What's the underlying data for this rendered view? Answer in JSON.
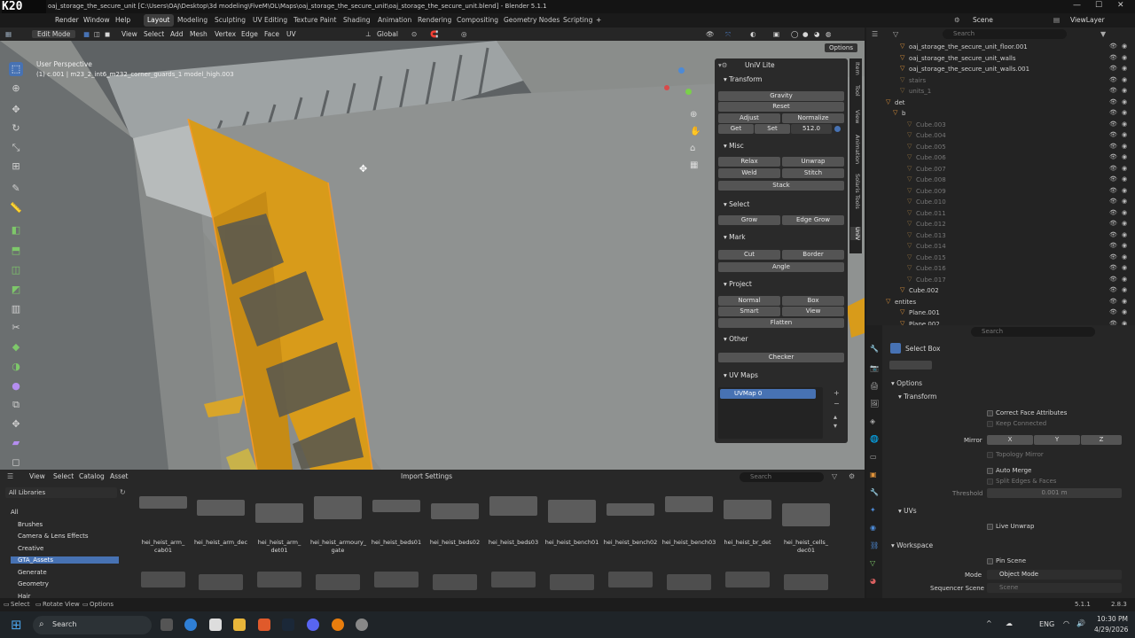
{
  "titlebar": {
    "logo": "K20",
    "title": "oaj_storage_the_secure_unit [C:\\Users\\OAJ\\Desktop\\3d modeling\\FiveM\\OL\\Maps\\oaj_storage_the_secure_unit\\oaj_storage_the_secure_unit.blend] - Blender 5.1.1"
  },
  "menu": {
    "items": [
      "Render",
      "Window",
      "Help"
    ],
    "workspaces": [
      "Layout",
      "Modeling",
      "Sculpting",
      "UV Editing",
      "Texture Paint",
      "Shading",
      "Animation",
      "Rendering",
      "Compositing",
      "Geometry Nodes",
      "Scripting"
    ],
    "active_workspace": "Layout",
    "add": "+",
    "scene": "Scene",
    "view_layer": "ViewLayer"
  },
  "viewport_header": {
    "mode": "Edit Mode",
    "menus": [
      "View",
      "Select",
      "Add",
      "Mesh",
      "Vertex",
      "Edge",
      "Face",
      "UV"
    ],
    "orientation": "Global",
    "options": "Options"
  },
  "viewport": {
    "perspective": "User Perspective",
    "object": "(1) c.001 | m23_2_int6_m232_corner_guards_1 model_high.003"
  },
  "uniV": {
    "title": "UniV Lite",
    "transform": {
      "title": "Transform",
      "gravity": "Gravity",
      "reset": "Reset",
      "adjust": "Adjust",
      "normalize": "Normalize",
      "get": "Get",
      "set": "Set",
      "value": "512.0"
    },
    "misc": {
      "title": "Misc",
      "relax": "Relax",
      "unwrap": "Unwrap",
      "weld": "Weld",
      "stitch": "Stitch",
      "stack": "Stack"
    },
    "select": {
      "title": "Select",
      "grow": "Grow",
      "edge_grow": "Edge Grow"
    },
    "mark": {
      "title": "Mark",
      "cut": "Cut",
      "border": "Border",
      "angle": "Angle"
    },
    "project": {
      "title": "Project",
      "normal": "Normal",
      "box": "Box",
      "smart": "Smart",
      "view": "View",
      "flatten": "Flatten"
    },
    "other": {
      "title": "Other",
      "checker": "Checker"
    },
    "uvmaps": {
      "title": "UV Maps",
      "map0": "UVMap 0"
    }
  },
  "side_tabs": [
    "Item",
    "Tool",
    "View",
    "Animation",
    "Solaris Tools",
    "UniV"
  ],
  "outliner": {
    "search_placeholder": "Search",
    "rows": [
      {
        "name": "oaj_storage_the_secure_unit_floor.001",
        "dim": false
      },
      {
        "name": "oaj_storage_the_secure_unit_walls",
        "dim": false
      },
      {
        "name": "oaj_storage_the_secure_unit_walls.001",
        "dim": false
      },
      {
        "name": "stairs",
        "dim": true
      },
      {
        "name": "units_1",
        "dim": true
      },
      {
        "name": "det",
        "dim": false
      },
      {
        "name": "b",
        "dim": false
      },
      {
        "name": "Cube.003",
        "dim": true
      },
      {
        "name": "Cube.004",
        "dim": true
      },
      {
        "name": "Cube.005",
        "dim": true
      },
      {
        "name": "Cube.006",
        "dim": true
      },
      {
        "name": "Cube.007",
        "dim": true
      },
      {
        "name": "Cube.008",
        "dim": true
      },
      {
        "name": "Cube.009",
        "dim": true
      },
      {
        "name": "Cube.010",
        "dim": true
      },
      {
        "name": "Cube.011",
        "dim": true
      },
      {
        "name": "Cube.012",
        "dim": true
      },
      {
        "name": "Cube.013",
        "dim": true
      },
      {
        "name": "Cube.014",
        "dim": true
      },
      {
        "name": "Cube.015",
        "dim": true
      },
      {
        "name": "Cube.016",
        "dim": true
      },
      {
        "name": "Cube.017",
        "dim": true
      },
      {
        "name": "Cube.002",
        "dim": false
      },
      {
        "name": "entites",
        "dim": false
      },
      {
        "name": "Plane.001",
        "dim": false
      },
      {
        "name": "Plane.002",
        "dim": false
      }
    ]
  },
  "properties": {
    "search_placeholder": "Search",
    "tool": "Select Box",
    "options": "Options",
    "transform": "Transform",
    "correct_face": "Correct Face Attributes",
    "keep_connected": "Keep Connected",
    "mirror": "Mirror",
    "x": "X",
    "y": "Y",
    "z": "Z",
    "topology_mirror": "Topology Mirror",
    "auto_merge": "Auto Merge",
    "split_edges": "Split Edges & Faces",
    "threshold": "Threshold",
    "threshold_value": "0.001 m",
    "uvs": "UVs",
    "live_unwrap": "Live Unwrap",
    "workspace": "Workspace",
    "pin_scene": "Pin Scene",
    "mode_label": "Mode",
    "mode_value": "Object Mode",
    "seq_label": "Sequencer Scene",
    "seq_value": "Scene"
  },
  "asset_browser": {
    "menus": [
      "View",
      "Select",
      "Catalog",
      "Asset"
    ],
    "import_settings": "Import Settings",
    "library": "All Libraries",
    "search_placeholder": "Search",
    "catalogs": [
      "All",
      "Brushes",
      "Camera & Lens Effects",
      "Creative",
      "GTA_Assets",
      "Generate",
      "Geometry",
      "Hair"
    ],
    "active_catalog": "GTA_Assets",
    "assets": [
      {
        "line1": "hei_heist_arm_",
        "line2": "cab01"
      },
      {
        "line1": "hei_heist_arm_dec",
        "line2": ""
      },
      {
        "line1": "hei_heist_arm_",
        "line2": "det01"
      },
      {
        "line1": "hei_heist_armoury_",
        "line2": "gate"
      },
      {
        "line1": "hei_heist_beds01",
        "line2": ""
      },
      {
        "line1": "hei_heist_beds02",
        "line2": ""
      },
      {
        "line1": "hei_heist_beds03",
        "line2": ""
      },
      {
        "line1": "hei_heist_bench01",
        "line2": ""
      },
      {
        "line1": "hei_heist_bench02",
        "line2": ""
      },
      {
        "line1": "hei_heist_bench03",
        "line2": ""
      },
      {
        "line1": "hei_heist_br_det",
        "line2": ""
      },
      {
        "line1": "hei_heist_cells_",
        "line2": "dec01"
      }
    ]
  },
  "statusbar": {
    "select": "Select",
    "rotate": "Rotate View",
    "options": "Options",
    "version": "5.1.1",
    "fps": "2.8.3"
  },
  "taskbar": {
    "search": "Search",
    "lang": "ENG",
    "time": "10:30 PM",
    "date": "4/29/2026"
  },
  "colors": {
    "accent": "#4772b3",
    "stripe_yellow": "#d89b1a",
    "selected_orange": "#f39a2b"
  }
}
